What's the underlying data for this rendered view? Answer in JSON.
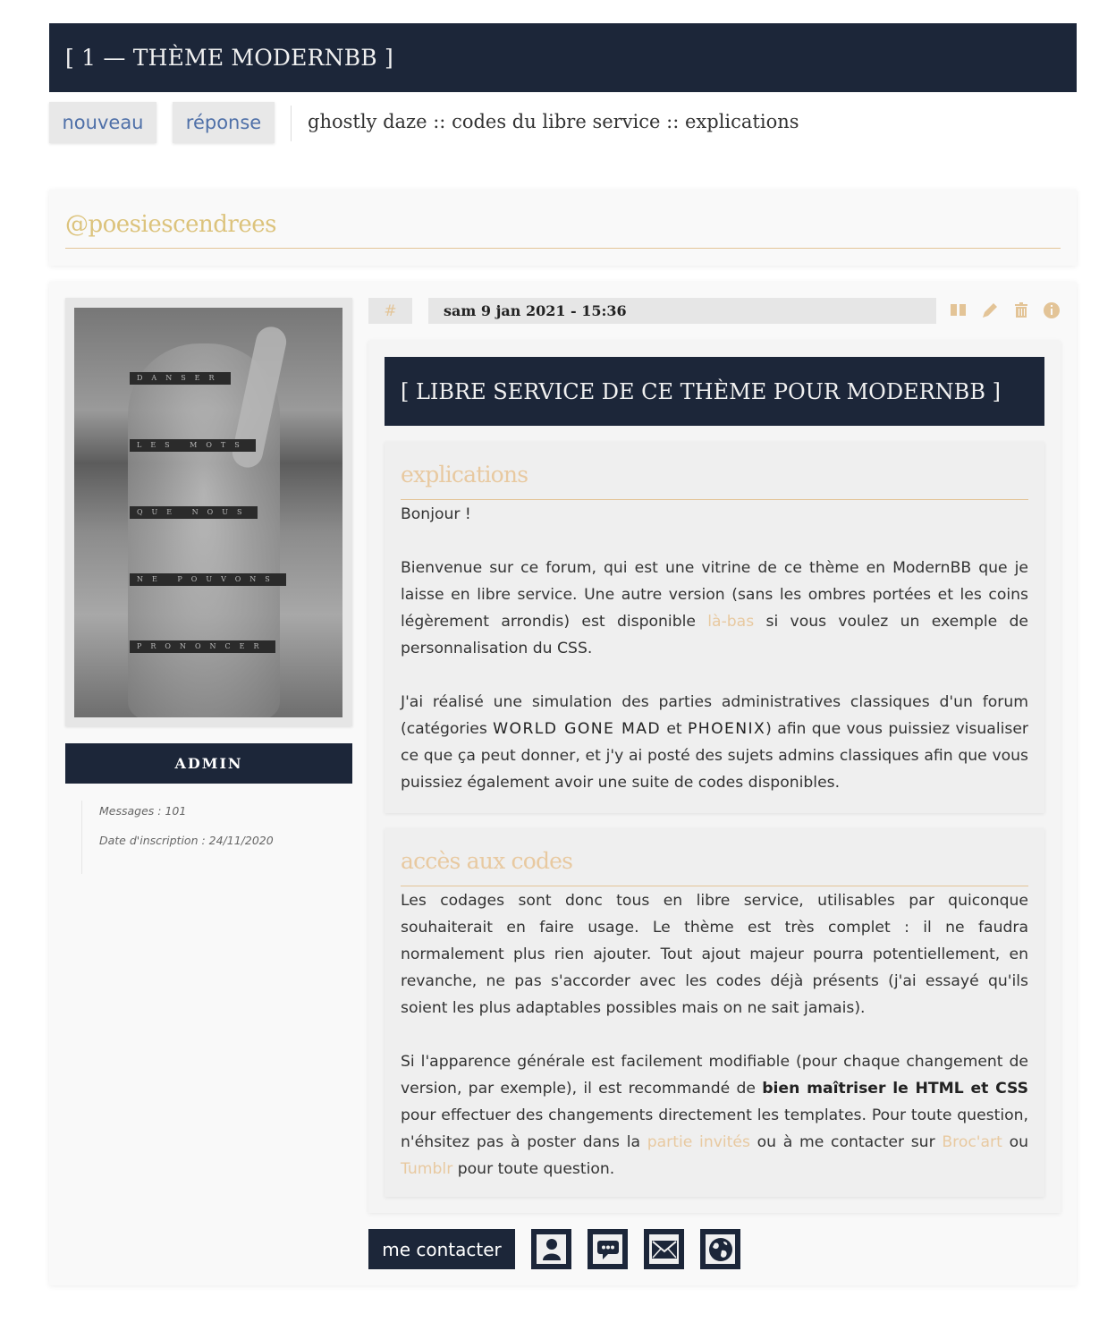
{
  "topic": {
    "title": "[ 1 — THÈME MODERNBB ]"
  },
  "actions": {
    "new_label": "nouveau",
    "reply_label": "réponse"
  },
  "breadcrumb": {
    "items": [
      "ghostly daze",
      "codes du libre service",
      "explications"
    ],
    "separator": " :: "
  },
  "author": {
    "name": "@poesiescendrees",
    "role": "ADMIN",
    "avatar_words": [
      "DANSER",
      "LES MOTS",
      "QUE NOUS",
      "NE POUVONS",
      "PRONONCER"
    ],
    "stats": [
      "Messages : 101",
      "Date d'inscription : 24/11/2020"
    ]
  },
  "post": {
    "hash_label": "#",
    "date": "sam 9 jan 2021 - 15:36",
    "icons": [
      "quote-icon",
      "edit-icon",
      "delete-icon",
      "info-icon"
    ],
    "title": "[ LIBRE SERVICE DE CE THÈME POUR MODERNBB ]",
    "sections": {
      "explications": {
        "title": "explications",
        "p1": "Bonjour !",
        "p2_a": "Bienvenue sur ce forum, qui est une vitrine de ce thème en ModernBB que je laisse en libre service. Une autre version (sans les ombres portées et les coins légèrement arrondis) est disponible ",
        "p2_link": "là-bas",
        "p2_b": " si vous voulez un exemple de personnalisation du CSS.",
        "p3_a": "J'ai réalisé une simulation des parties administratives classiques d'un forum (catégories ",
        "p3_cat1": "WORLD GONE MAD",
        "p3_mid": " et ",
        "p3_cat2": "PHOENIX",
        "p3_b": ") afin que vous puissiez visualiser ce que ça peut donner, et j'y ai posté des sujets admins classiques afin que vous puissiez également avoir une suite de codes disponibles."
      },
      "acces": {
        "title": "accès aux codes",
        "p1": "Les codages sont donc tous en libre service, utilisables par quiconque souhaiterait en faire usage. Le thème est très complet : il ne faudra normalement plus rien ajouter. Tout ajout majeur pourra potentiellement, en revanche, ne pas s'accorder avec les codes déjà présents (j'ai essayé qu'ils soient les plus adaptables possibles mais on ne sait jamais).",
        "p2_a": "Si l'apparence générale est facilement modifiable (pour chaque changement de version, par exemple), il est recommandé de ",
        "p2_strong": "bien maîtriser le HTML et CSS",
        "p2_b": " pour effectuer des changements directement les templates.  Pour toute question, n'éhsitez pas à poster dans la ",
        "p2_link1": "partie invités",
        "p2_c": " ou à me contacter sur ",
        "p2_link2": "Broc'art",
        "p2_d": " ou ",
        "p2_link3": "Tumblr",
        "p2_e": " pour toute question."
      }
    }
  },
  "contact": {
    "button_label": "me contacter",
    "icons": [
      "profile-icon",
      "private-message-icon",
      "email-icon",
      "website-icon"
    ]
  },
  "colors": {
    "navy": "#1c2639",
    "gold": "#dcc37c",
    "peach": "#e8c9a0",
    "link_blue": "#4f70a8"
  }
}
